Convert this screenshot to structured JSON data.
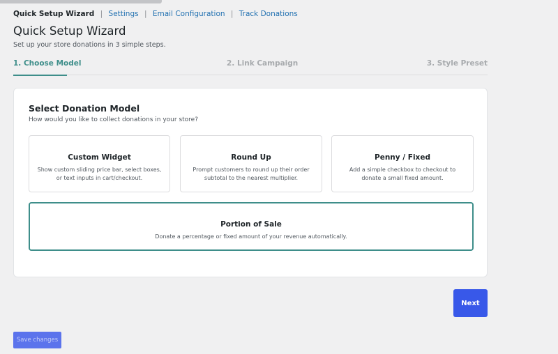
{
  "subnav": {
    "current": "Quick Setup Wizard",
    "links": [
      "Settings",
      "Email Configuration",
      "Track Donations"
    ],
    "separator": "|"
  },
  "header": {
    "title": "Quick Setup Wizard",
    "subtitle": "Set up your store donations in 3 simple steps."
  },
  "steps": [
    {
      "label": "1. Choose Model",
      "active": true
    },
    {
      "label": "2. Link Campaign",
      "active": false
    },
    {
      "label": "3. Style Preset",
      "active": false
    }
  ],
  "card": {
    "title": "Select Donation Model",
    "description": "How would you like to collect donations in your store?",
    "options": [
      {
        "title": "Custom Widget",
        "description": "Show custom sliding price bar, select boxes, or text inputs in cart/checkout."
      },
      {
        "title": "Round Up",
        "description": "Prompt customers to round up their order subtotal to the nearest multiplier."
      },
      {
        "title": "Penny / Fixed",
        "description": "Add a simple checkbox to checkout to donate a small fixed amount."
      },
      {
        "title": "Portion of Sale",
        "description": "Donate a percentage or fixed amount of your revenue automatically.",
        "selected": true
      }
    ]
  },
  "buttons": {
    "next": "Next",
    "save": "Save changes"
  },
  "colors": {
    "accent": "#3e8e8a",
    "primary": "#3858e9",
    "link": "#2271b1"
  }
}
